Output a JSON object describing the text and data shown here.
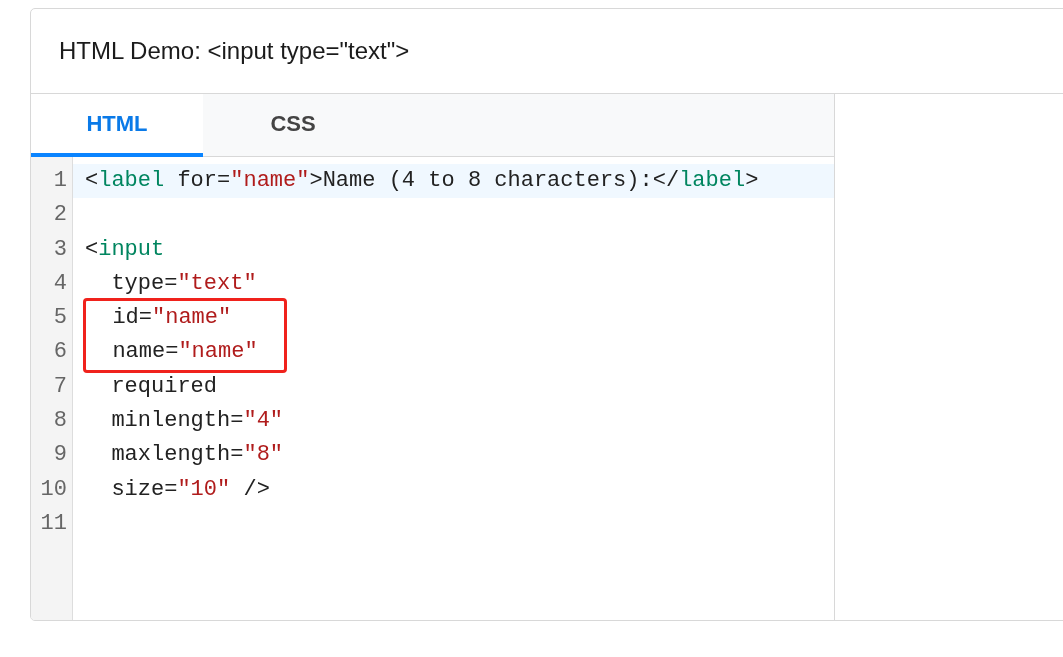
{
  "demo": {
    "title": "HTML Demo: <input type=\"text\">"
  },
  "tabs": [
    {
      "label": "HTML",
      "selected": true
    },
    {
      "label": "CSS",
      "selected": false
    }
  ],
  "lines": [
    {
      "number": "1",
      "active": true,
      "boxed": false,
      "tokens": [
        {
          "kind": "punct",
          "text": "<"
        },
        {
          "kind": "tag",
          "text": "label"
        },
        {
          "kind": "attr",
          "text": " for="
        },
        {
          "kind": "string",
          "text": "\"name\""
        },
        {
          "kind": "punct",
          "text": ">Name (4 to 8 characters):</"
        },
        {
          "kind": "tag",
          "text": "label"
        },
        {
          "kind": "punct",
          "text": ">"
        }
      ]
    },
    {
      "number": "2",
      "active": false,
      "boxed": false
    },
    {
      "number": "3",
      "active": false,
      "boxed": false,
      "tokens": [
        {
          "kind": "punct",
          "text": "<"
        },
        {
          "kind": "tag",
          "text": "input"
        }
      ]
    },
    {
      "number": "4",
      "active": false,
      "boxed": false,
      "tokens": [
        {
          "kind": "attr",
          "text": "  type="
        },
        {
          "kind": "string",
          "text": "\"text\""
        }
      ]
    },
    {
      "number": "5",
      "active": false,
      "boxed": true,
      "tokens": [
        {
          "kind": "attr",
          "text": "  id="
        },
        {
          "kind": "string",
          "text": "\"name\""
        }
      ]
    },
    {
      "number": "6",
      "active": false,
      "boxed": true,
      "tokens": [
        {
          "kind": "attr",
          "text": "  name="
        },
        {
          "kind": "string",
          "text": "\"name\""
        }
      ]
    },
    {
      "number": "7",
      "active": false,
      "boxed": false,
      "tokens": [
        {
          "kind": "attr",
          "text": "  required"
        }
      ]
    },
    {
      "number": "8",
      "active": false,
      "boxed": false,
      "tokens": [
        {
          "kind": "attr",
          "text": "  minlength="
        },
        {
          "kind": "string",
          "text": "\"4\""
        }
      ]
    },
    {
      "number": "9",
      "active": false,
      "boxed": false,
      "tokens": [
        {
          "kind": "attr",
          "text": "  maxlength="
        },
        {
          "kind": "string",
          "text": "\"8\""
        }
      ]
    },
    {
      "number": "10",
      "active": false,
      "boxed": false,
      "tokens": [
        {
          "kind": "attr",
          "text": "  size="
        },
        {
          "kind": "string",
          "text": "\"10\""
        },
        {
          "kind": "punct",
          "text": " />"
        }
      ]
    },
    {
      "number": "11",
      "active": false,
      "boxed": false
    }
  ]
}
